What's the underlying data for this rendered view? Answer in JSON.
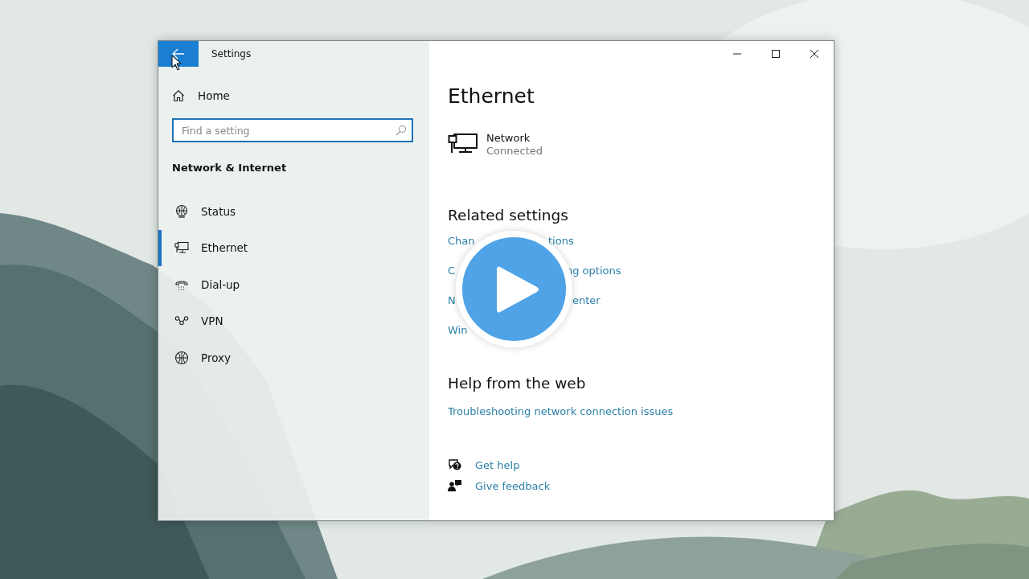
{
  "window": {
    "title": "Settings"
  },
  "sidebar": {
    "home": "Home",
    "search": {
      "placeholder": "Find a setting"
    },
    "section": "Network & Internet",
    "items": [
      {
        "label": "Status",
        "selected": false
      },
      {
        "label": "Ethernet",
        "selected": true
      },
      {
        "label": "Dial-up",
        "selected": false
      },
      {
        "label": "VPN",
        "selected": false
      },
      {
        "label": "Proxy",
        "selected": false
      }
    ]
  },
  "page": {
    "title": "Ethernet",
    "network": {
      "name": "Network",
      "status": "Connected"
    },
    "related": {
      "heading": "Related settings",
      "links": [
        {
          "start": "Chan",
          "end": "tions"
        },
        {
          "start": "C",
          "end": "ng options"
        },
        {
          "start": "N",
          "end": "enter"
        },
        {
          "start": "Win"
        }
      ]
    },
    "help": {
      "heading": "Help from the web",
      "links": [
        "Troubleshooting network connection issues"
      ]
    },
    "actions": [
      "Get help",
      "Give feedback"
    ]
  }
}
